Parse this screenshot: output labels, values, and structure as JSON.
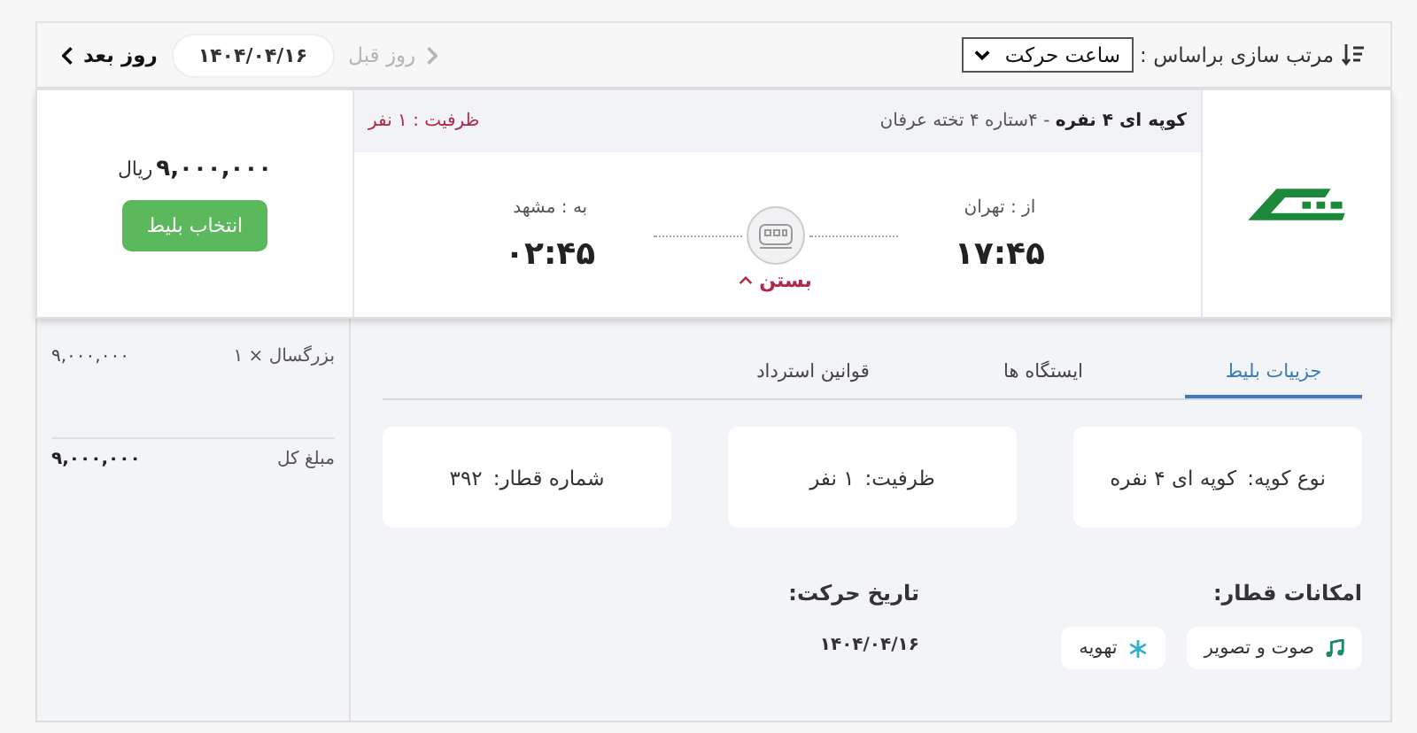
{
  "toolbar": {
    "sort_label": "مرتب سازی براساس :",
    "sort_value": "ساعت حرکت",
    "prev_day": {
      "label": "روز قبل",
      "disabled": true
    },
    "date": "۱۴۰۴/۰۴/۱۶",
    "next_day": {
      "label": "روز بعد",
      "disabled": false
    }
  },
  "ticket": {
    "title": "**کوپه ای ۴ نفره** - ۴ستاره ۴ تخته عرفان",
    "capacity": "ظرفیت : ۱ نفر",
    "origin": {
      "label": "از : تهران",
      "time": "۱۷:۴۵"
    },
    "destination": {
      "label": "به : مشهد",
      "time": "۰۲:۴۵"
    },
    "toggle": {
      "label": "بستن",
      "expanded": true
    },
    "price": "۹,۰۰۰,۰۰۰",
    "currency": "ریال",
    "select_button": "انتخاب بلیط"
  },
  "summary": [
    {
      "label": "بزرگسال × ۱",
      "amount": "۹,۰۰۰,۰۰۰",
      "total": false
    },
    {
      "label": "مبلغ کل",
      "amount": "۹,۰۰۰,۰۰۰",
      "total": true
    }
  ],
  "tabs": [
    {
      "label": "جزییات بلیط",
      "selected": true
    },
    {
      "label": "ایستگاه ها",
      "selected": false
    },
    {
      "label": "قوانین استرداد",
      "selected": false
    }
  ],
  "info": [
    {
      "label": "نوع کوپه:",
      "value": "کوپه ای ۴ نفره"
    },
    {
      "label": "ظرفیت:",
      "value": "۱ نفر"
    },
    {
      "label": "شماره قطار:",
      "value": "۳۹۲"
    }
  ],
  "amenities": {
    "title": "امکانات قطار:",
    "items": [
      {
        "kind": "music",
        "label": "صوت و تصویر"
      },
      {
        "kind": "snow",
        "label": "تهویه"
      }
    ]
  },
  "departure": {
    "title": "تاریخ حرکت:",
    "date": "۱۴۰۴/۰۴/۱۶"
  }
}
